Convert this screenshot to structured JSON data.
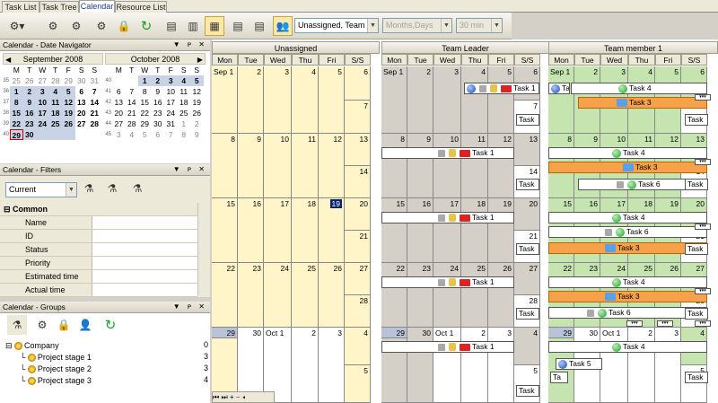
{
  "tabs": [
    "Task List",
    "Task Tree",
    "Calendar",
    "Resource List"
  ],
  "toolbar": {
    "resource_combo": "Unassigned, Team Le",
    "scale_combo": "Months,Days",
    "interval_combo": "30 min"
  },
  "navigator": {
    "title": "Calendar - Date Navigator",
    "controls": "▼ ᴘ ✕",
    "month1": "September 2008",
    "month2": "October 2008",
    "dow": [
      "M",
      "T",
      "W",
      "T",
      "F",
      "S",
      "S"
    ],
    "sep_weeks": [
      "35",
      "36",
      "37",
      "38",
      "39",
      "40"
    ],
    "oct_weeks": [
      "40",
      "41",
      "42",
      "43",
      "44",
      "45"
    ],
    "sep": [
      [
        "25",
        "26",
        "27",
        "28",
        "29",
        "30",
        "31"
      ],
      [
        "1",
        "2",
        "3",
        "4",
        "5",
        "6",
        "7"
      ],
      [
        "8",
        "9",
        "10",
        "11",
        "12",
        "13",
        "14"
      ],
      [
        "15",
        "16",
        "17",
        "18",
        "19",
        "20",
        "21"
      ],
      [
        "22",
        "23",
        "24",
        "25",
        "26",
        "27",
        "28"
      ],
      [
        "29",
        "30",
        "",
        "",
        "",
        "",
        ""
      ]
    ],
    "oct": [
      [
        "",
        "",
        "1",
        "2",
        "3",
        "4",
        "5"
      ],
      [
        "6",
        "7",
        "8",
        "9",
        "10",
        "11",
        "12"
      ],
      [
        "13",
        "14",
        "15",
        "16",
        "17",
        "18",
        "19"
      ],
      [
        "20",
        "21",
        "22",
        "23",
        "24",
        "25",
        "26"
      ],
      [
        "27",
        "28",
        "29",
        "30",
        "31",
        "1",
        "2"
      ],
      [
        "3",
        "4",
        "5",
        "6",
        "7",
        "8",
        "9"
      ]
    ]
  },
  "filters": {
    "title": "Calendar - Filters",
    "combo": "Current",
    "group": "Common",
    "rows": [
      "Name",
      "ID",
      "Status",
      "Priority",
      "Estimated time",
      "Actual time"
    ]
  },
  "groups": {
    "title": "Calendar - Groups",
    "root": "Company",
    "root_count": "0",
    "items": [
      {
        "label": "Project stage 1",
        "count": "3"
      },
      {
        "label": "Project stage 2",
        "count": "3"
      },
      {
        "label": "Project stage 3",
        "count": "4"
      }
    ]
  },
  "resources": [
    "Unassigned",
    "Team Leader",
    "Team member 1"
  ],
  "days": [
    "Mon",
    "Tue",
    "Wed",
    "Thu",
    "Fri",
    "S/S"
  ],
  "weeks": [
    [
      "Sep 1",
      "2",
      "3",
      "4",
      "5",
      "6",
      "7"
    ],
    [
      "8",
      "9",
      "10",
      "11",
      "12",
      "13",
      "14"
    ],
    [
      "15",
      "16",
      "17",
      "18",
      "19",
      "20",
      "21"
    ],
    [
      "22",
      "23",
      "24",
      "25",
      "26",
      "27",
      "28"
    ],
    [
      "29",
      "30",
      "Oct 1",
      "2",
      "3",
      "4",
      "5"
    ]
  ],
  "events": {
    "task1": "Task 1",
    "task3": "Task 3",
    "task4": "Task 4",
    "task5": "Task 5",
    "task6": "Task 6",
    "task": "Task",
    "ta": "Ta"
  },
  "colors": {
    "unassigned_bg": "#fff5c8",
    "leader_bg": "#d4d0c8",
    "member_bg": "#c6e4b0",
    "selected": "#0a246a",
    "orange": "#f7a24a"
  }
}
